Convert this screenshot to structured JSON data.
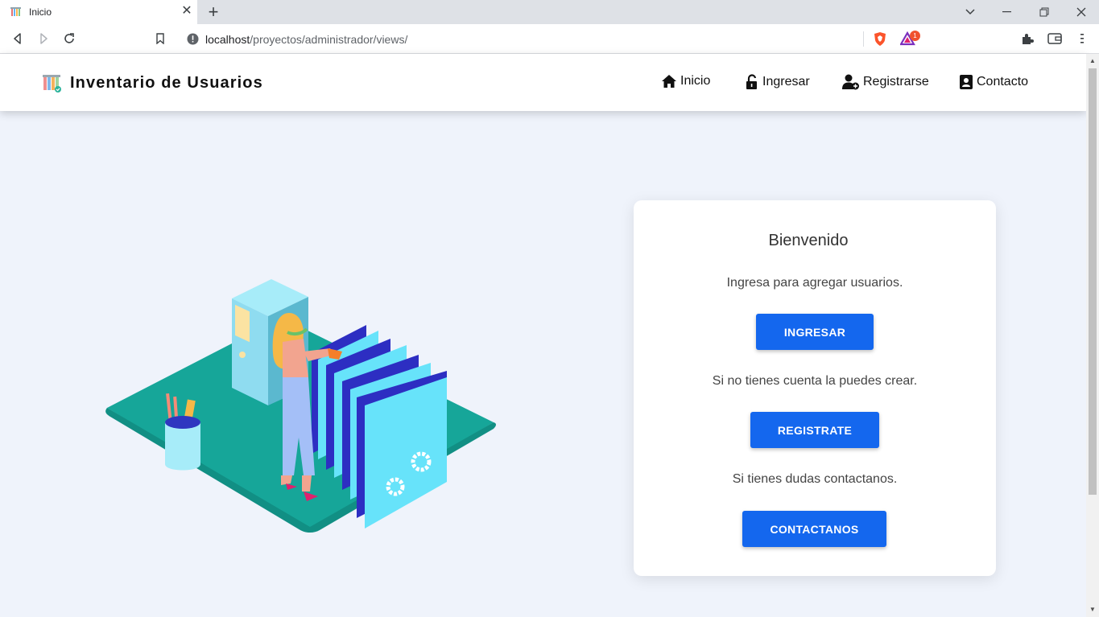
{
  "browser": {
    "tab_title": "Inicio",
    "url_host": "localhost",
    "url_path": "/proyectos/administrador/views/",
    "notification_count": "1"
  },
  "navbar": {
    "brand": "Inventario de Usuarios",
    "links": [
      {
        "label": "Inicio",
        "icon": "home-icon"
      },
      {
        "label": "Ingresar",
        "icon": "lock-icon"
      },
      {
        "label": "Registrarse",
        "icon": "user-plus-icon"
      },
      {
        "label": "Contacto",
        "icon": "contact-card-icon"
      }
    ]
  },
  "card": {
    "title": "Bienvenido",
    "login_text": "Ingresa para agregar usuarios.",
    "login_button": "INGRESAR",
    "register_text": "Si no tienes cuenta la puedes crear.",
    "register_button": "REGISTRATE",
    "contact_text": "Si tienes dudas contactanos.",
    "contact_button": "CONTACTANOS"
  },
  "colors": {
    "page_bg": "#eff3fb",
    "primary": "#1467ee",
    "platform": "#16a699"
  }
}
